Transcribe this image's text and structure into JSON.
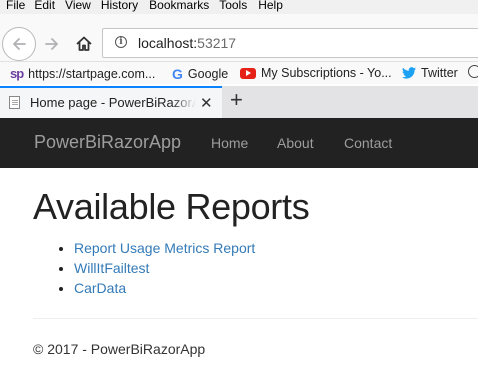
{
  "menu": {
    "items": [
      "File",
      "Edit",
      "View",
      "History",
      "Bookmarks",
      "Tools",
      "Help"
    ]
  },
  "toolbar": {
    "url_host": "localhost:",
    "url_port": "53217"
  },
  "bookmarks": [
    {
      "icon": "startpage-icon",
      "logo_text": "sp",
      "label": "https://startpage.com..."
    },
    {
      "icon": "google-icon",
      "logo_text": "G",
      "label": "Google"
    },
    {
      "icon": "youtube-icon",
      "label": "My Subscriptions - Yo..."
    },
    {
      "icon": "twitter-icon",
      "label": "Twitter"
    }
  ],
  "tab": {
    "title": "Home page - PowerBiRazorApp",
    "close_glyph": "✕",
    "new_tab_glyph": "+"
  },
  "site_nav": {
    "brand": "PowerBiRazorApp",
    "links": [
      "Home",
      "About",
      "Contact"
    ]
  },
  "main": {
    "title": "Available Reports",
    "reports": [
      "Report Usage Metrics Report",
      "WillItFailtest",
      "CarData"
    ]
  },
  "footer": {
    "text": "© 2017 - PowerBiRazorApp"
  },
  "colors": {
    "navbar_bg": "#222222",
    "nav_text": "#9d9d9d",
    "link": "#337ab7",
    "tab_accent": "#0a84ff"
  }
}
